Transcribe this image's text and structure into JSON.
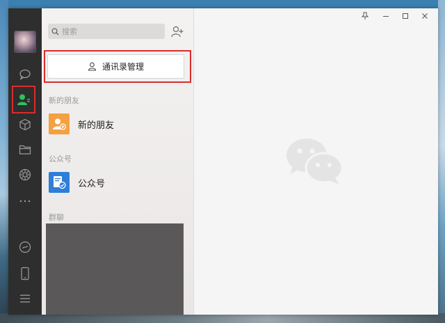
{
  "search": {
    "placeholder": "搜索"
  },
  "contacts": {
    "manage_label": "通讯录管理",
    "sections": [
      {
        "title": "新的朋友",
        "item_label": "新的朋友",
        "icon": "new-friend-icon",
        "color": "#f5a041"
      },
      {
        "title": "公众号",
        "item_label": "公众号",
        "icon": "official-account-icon",
        "color": "#2f7ed8"
      },
      {
        "title": "群聊"
      }
    ]
  },
  "nav": {
    "items": [
      "chat-icon",
      "contacts-icon",
      "favorites-cube-icon",
      "folder-icon",
      "moments-aperture-icon",
      "more-icon",
      "mini-program-icon",
      "phone-icon",
      "menu-icon"
    ],
    "active": "contacts-icon"
  },
  "window_controls": [
    "pin-icon",
    "minimize-icon",
    "maximize-icon",
    "close-icon"
  ],
  "colors": {
    "accent_green": "#2ec25a",
    "highlight_red": "#d92c2c",
    "nav_bg": "#2e2e2e"
  }
}
